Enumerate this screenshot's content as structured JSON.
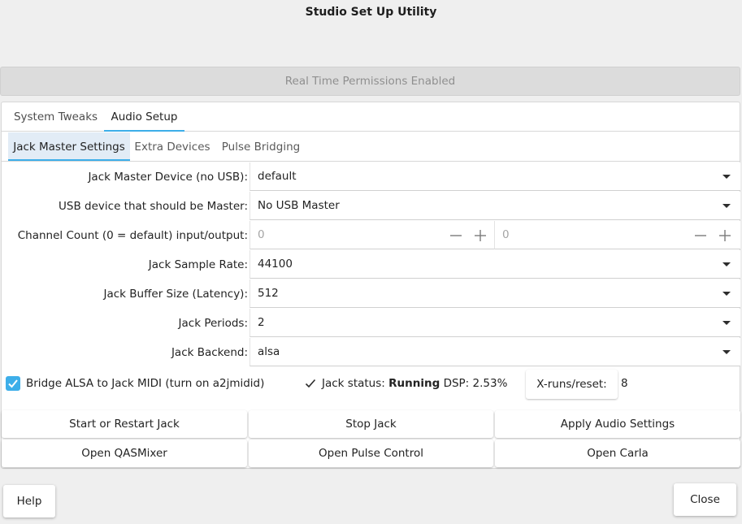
{
  "window": {
    "title": "Studio Set Up Utility"
  },
  "rt_status": "Real Time Permissions Enabled",
  "tabs": [
    {
      "label": "System Tweaks",
      "active": false
    },
    {
      "label": "Audio Setup",
      "active": true
    }
  ],
  "subtabs": [
    {
      "label": "Jack Master Settings",
      "active": true
    },
    {
      "label": "Extra Devices",
      "active": false
    },
    {
      "label": "Pulse Bridging",
      "active": false
    }
  ],
  "form": {
    "master_device": {
      "label": "Jack Master Device (no USB):",
      "value": "default"
    },
    "usb_master": {
      "label": "USB device that should be Master:",
      "value": "No USB Master"
    },
    "channel_count": {
      "label": "Channel Count (0 = default) input/output:",
      "input_value": "0",
      "output_value": "0"
    },
    "sample_rate": {
      "label": "Jack Sample Rate:",
      "value": "44100"
    },
    "buffer_size": {
      "label": "Jack Buffer Size (Latency):",
      "value": "512"
    },
    "periods": {
      "label": "Jack Periods:",
      "value": "2"
    },
    "backend": {
      "label": "Jack Backend:",
      "value": "alsa"
    }
  },
  "bridge_midi": {
    "label": "Bridge ALSA to Jack MIDI (turn on a2jmidid)",
    "checked": true
  },
  "jack_status": {
    "label": "Jack status:",
    "state": "Running",
    "dsp": "DSP: 2.53%"
  },
  "xruns": {
    "button_label": "X-runs/reset:",
    "value": "8"
  },
  "actions": {
    "restart_jack": "Start or Restart  Jack",
    "stop_jack": "Stop Jack",
    "apply_audio": "Apply Audio Settings",
    "open_qasmixer": "Open QASMixer",
    "open_pulse_control": "Open Pulse Control",
    "open_carla": "Open Carla"
  },
  "footer": {
    "help": "Help",
    "close": "Close"
  },
  "colors": {
    "accent": "#3daee9",
    "selected_tab_bg": "#e2ecf6",
    "window_bg": "#efefef"
  },
  "icons": {
    "checkbox": "check-icon",
    "status": "checkmark-icon",
    "dropdown": "chevron-down-icon",
    "spin_minus": "minus-icon",
    "spin_plus": "plus-icon"
  }
}
